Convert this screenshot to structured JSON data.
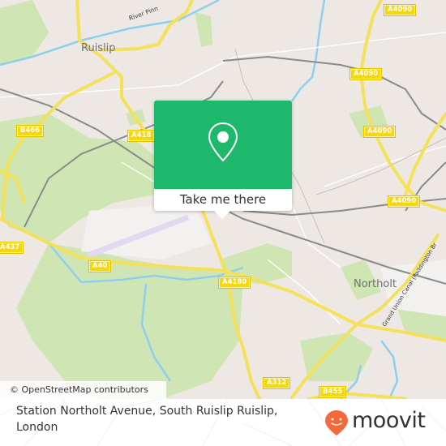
{
  "map": {
    "place_labels": [
      {
        "name": "ruislip",
        "text": "Ruislip"
      },
      {
        "name": "northolt",
        "text": "Northolt"
      }
    ],
    "water_labels": [
      {
        "name": "river-pinn",
        "text": "River Pinn"
      },
      {
        "name": "grand-union-canal",
        "text": "Grand Union Canal (Paddington Branch)"
      }
    ],
    "road_shields": [
      {
        "name": "a4090-top",
        "text": "A4090"
      },
      {
        "name": "a4090-upper",
        "text": "A4090"
      },
      {
        "name": "a4090-middle",
        "text": "A4090"
      },
      {
        "name": "a4090-lower",
        "text": "A4090"
      },
      {
        "name": "b466",
        "text": "B466"
      },
      {
        "name": "a418",
        "text": "A418"
      },
      {
        "name": "a437",
        "text": "A437"
      },
      {
        "name": "a40",
        "text": "A40"
      },
      {
        "name": "a4180",
        "text": "A4180"
      },
      {
        "name": "a312",
        "text": "A312"
      },
      {
        "name": "b455",
        "text": "B455"
      }
    ],
    "attribution": "© OpenStreetMap contributors"
  },
  "popup": {
    "icon": "map-pin-icon",
    "button_label": "Take me there",
    "accent_color": "#1db86b"
  },
  "footer": {
    "address": "Station Northolt Avenue, South Ruislip Ruislip, London",
    "brand": "moovit",
    "brand_color": "#f4683a"
  }
}
